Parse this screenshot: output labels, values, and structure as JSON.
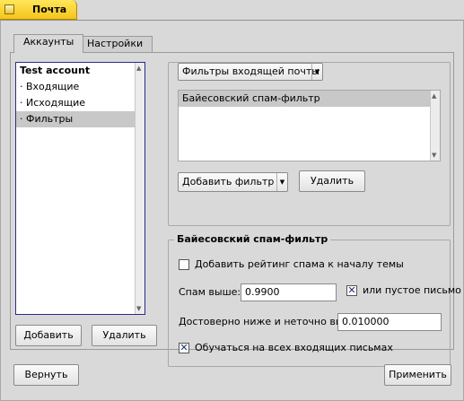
{
  "window": {
    "title": "Почта"
  },
  "tabs": [
    {
      "label": "Аккаунты"
    },
    {
      "label": "Настройки"
    }
  ],
  "accounts": {
    "tree": [
      {
        "label": "Test account",
        "header": true
      },
      {
        "label": "· Входящие"
      },
      {
        "label": "· Исходящие"
      },
      {
        "label": "· Фильтры",
        "selected": true
      }
    ],
    "add_label": "Добавить",
    "remove_label": "Удалить"
  },
  "filters": {
    "type_selected": "Фильтры входящей почты",
    "list": [
      {
        "label": "Байесовский спам-фильтр"
      }
    ],
    "add_filter_label": "Добавить фильтр",
    "delete_label": "Удалить"
  },
  "bayes": {
    "title": "Байесовский спам-фильтр",
    "prepend_rating": {
      "label": "Добавить рейтинг спама к началу темы",
      "checked": false
    },
    "spam_above_label": "Спам выше:",
    "spam_above_value": "0.9900",
    "or_empty": {
      "label": "или пустое письмо",
      "checked": true
    },
    "confident_label": "Достоверно ниже и неточно выше:",
    "confident_value": "0.010000",
    "learn_all": {
      "label": "Обучаться на всех входящих письмах",
      "checked": true
    }
  },
  "footer": {
    "revert_label": "Вернуть",
    "apply_label": "Применить"
  }
}
